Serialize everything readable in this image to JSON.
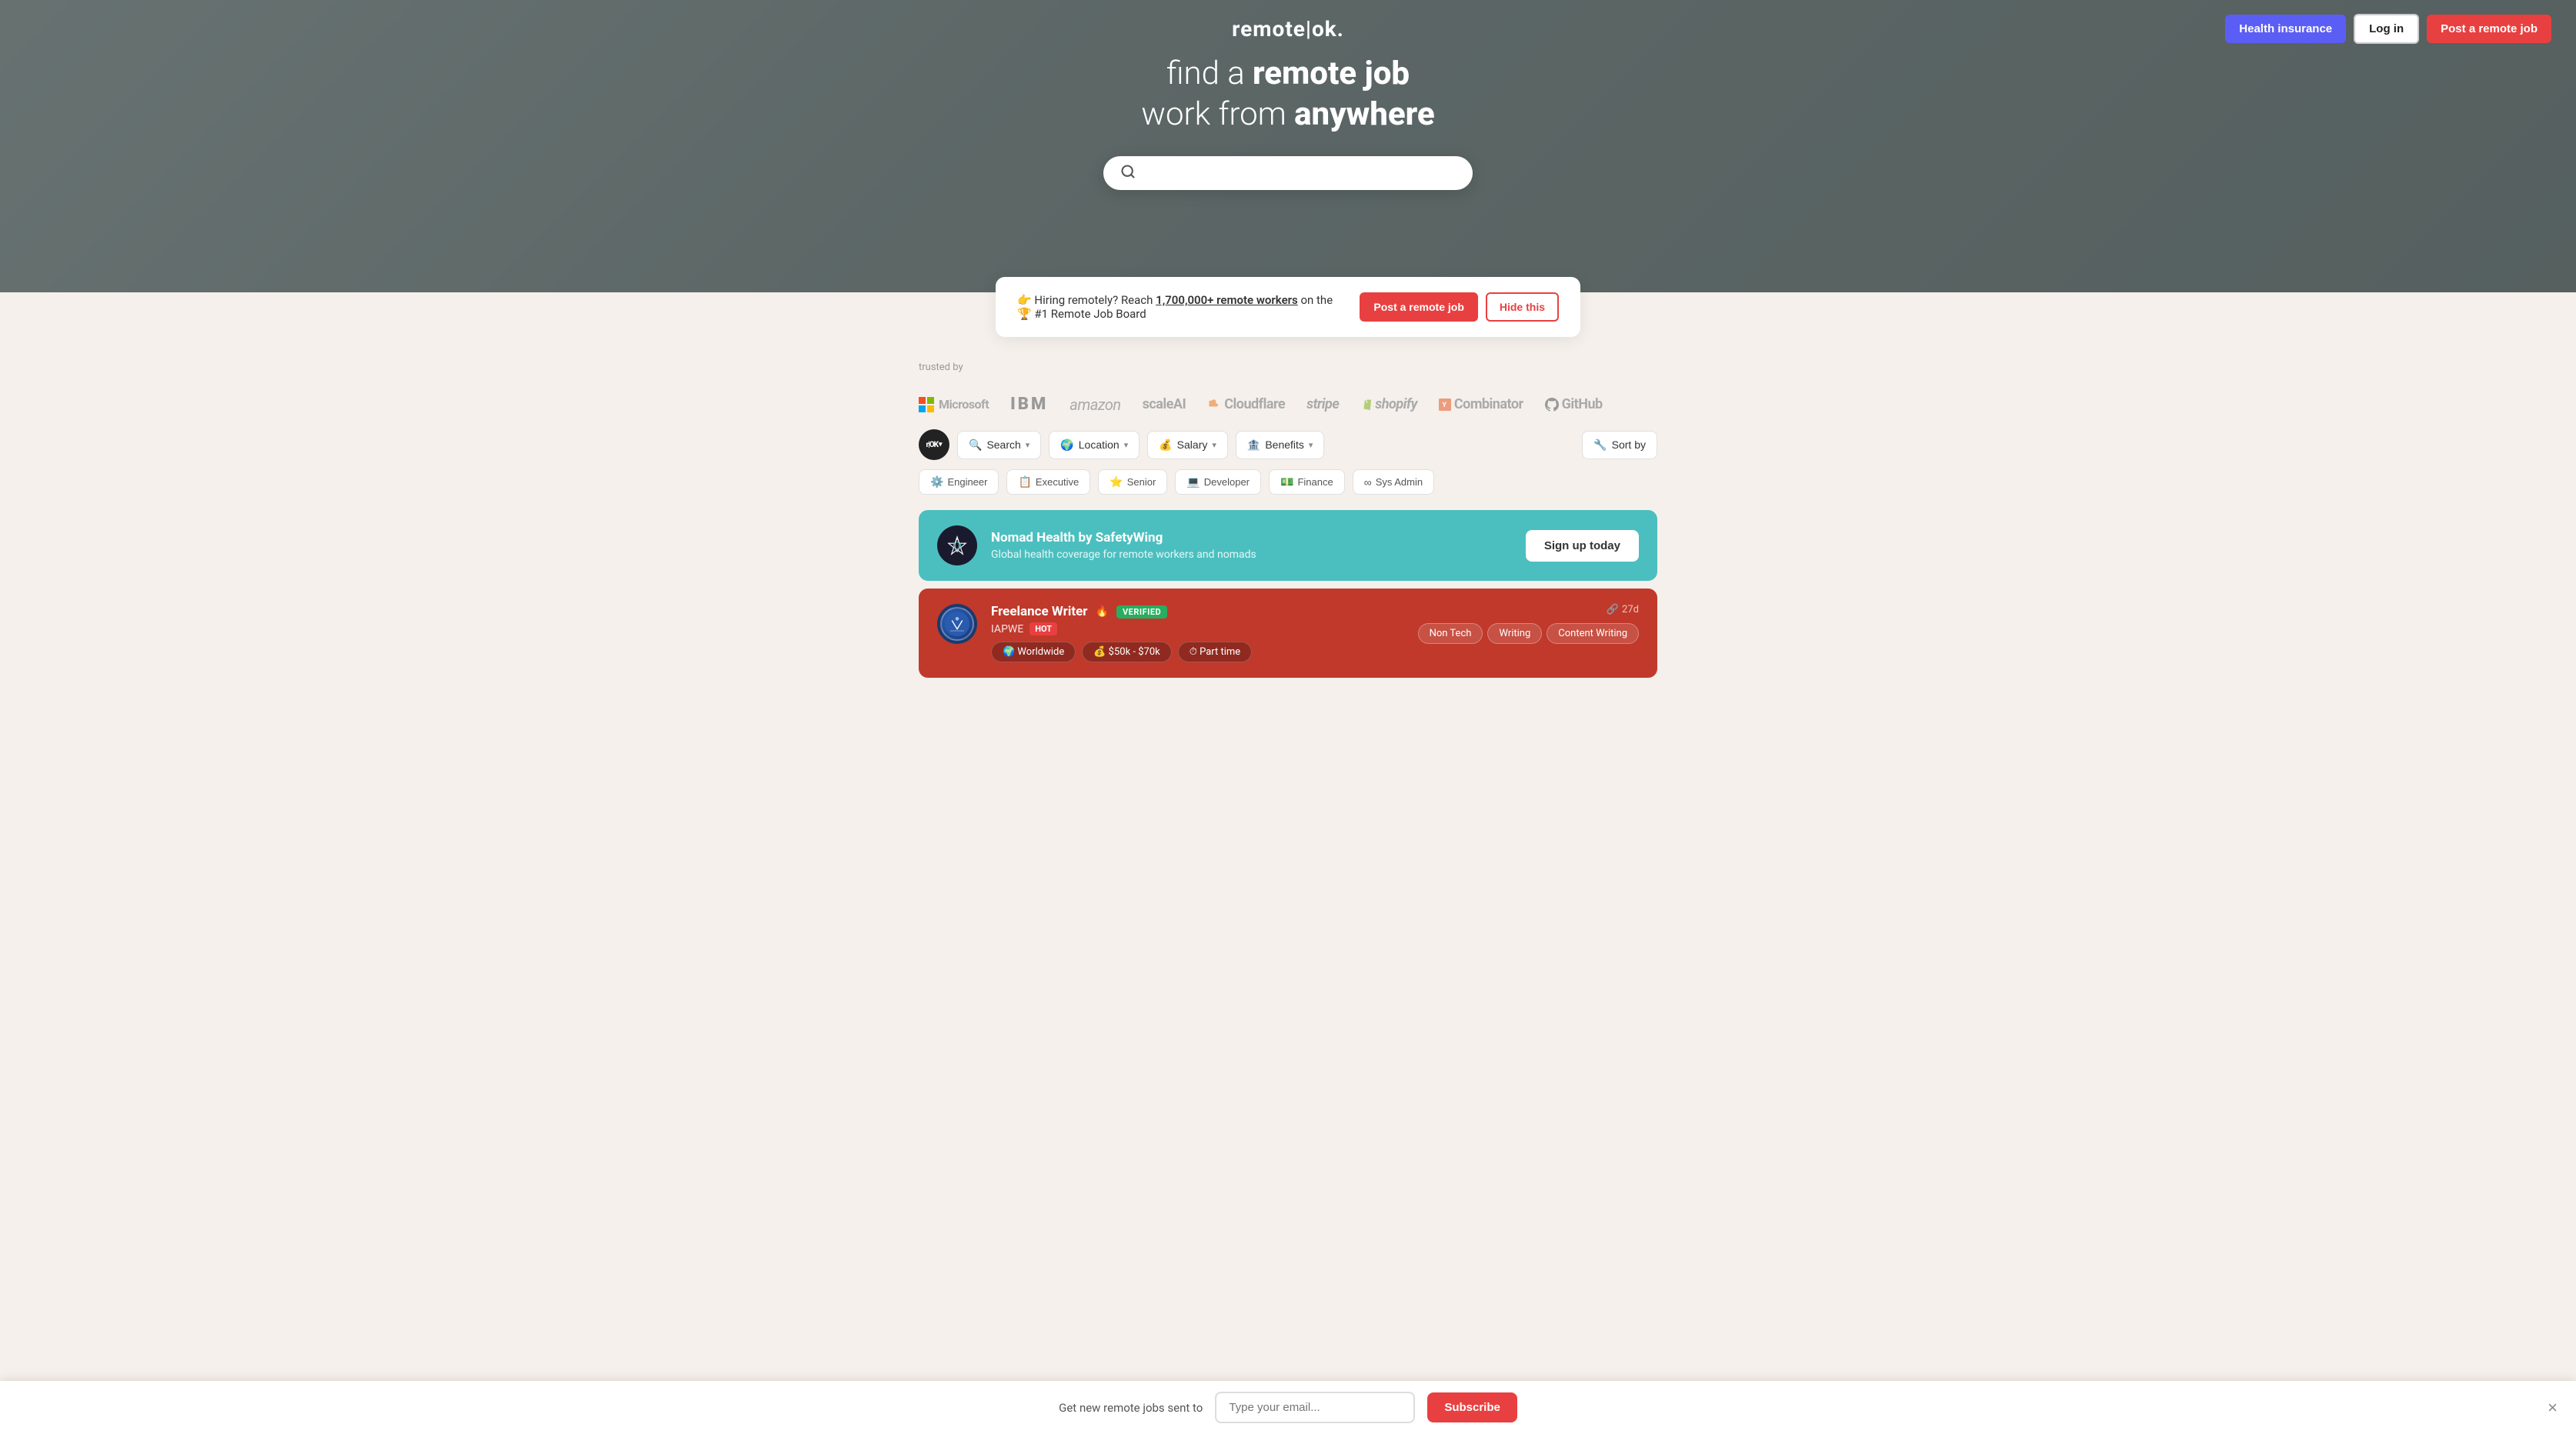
{
  "nav": {
    "logo": "remote|ok.",
    "logo_r": "r|ok",
    "health_label": "Health insurance",
    "login_label": "Log in",
    "post_label": "Post a remote job"
  },
  "hero": {
    "line1": "find a ",
    "line1_bold": "remote job",
    "line2": "work from ",
    "line2_bold": "anywhere",
    "search_placeholder": ""
  },
  "promo": {
    "emoji": "👉",
    "text": "Hiring remotely? Reach ",
    "link": "1,700,000+ remote workers",
    "suffix": " on the 🏆 #1 Remote Job Board",
    "post_label": "Post a remote job",
    "hide_label": "Hide this"
  },
  "trusted": {
    "label": "trusted by",
    "logos": [
      "Microsoft",
      "IBM",
      "amazon",
      "scaleAI",
      "Cloudflare",
      "stripe",
      "shopify",
      "Y Combinator",
      "GitHub"
    ]
  },
  "filters": {
    "logo_text": "r|OK",
    "search_label": "Search",
    "location_label": "Location",
    "salary_label": "Salary",
    "benefits_label": "Benefits",
    "sortby_label": "Sort by",
    "search_icon": "🔍",
    "location_icon": "🌍",
    "salary_icon": "💰",
    "benefits_icon": "🏦",
    "sortby_icon": "🔧"
  },
  "categories": [
    {
      "icon": "⚙️",
      "label": "Engineer"
    },
    {
      "icon": "📋",
      "label": "Executive"
    },
    {
      "icon": "⭐",
      "label": "Senior"
    },
    {
      "icon": "💻",
      "label": "Developer"
    },
    {
      "icon": "💵",
      "label": "Finance"
    },
    {
      "icon": "∞",
      "label": "Sys Admin"
    }
  ],
  "nomad_card": {
    "company": "Nomad Health by SafetyWing",
    "desc": "Global health coverage for remote workers and nomads",
    "cta": "Sign up today"
  },
  "job_card": {
    "title": "Freelance Writer",
    "fire_emoji": "🔥",
    "verified_label": "VERIFIED",
    "hot_label": "HOT",
    "company": "IAPWE",
    "location": "Worldwide",
    "salary": "$50k - $70k",
    "type": "Part time",
    "tags": [
      "Non Tech",
      "Writing",
      "Content Writing"
    ],
    "time_icon": "🔗",
    "time": "27d"
  },
  "email_bar": {
    "text": "Get new remote jobs sent to",
    "placeholder": "Type your email...",
    "subscribe_label": "Subscribe",
    "close": "×"
  }
}
